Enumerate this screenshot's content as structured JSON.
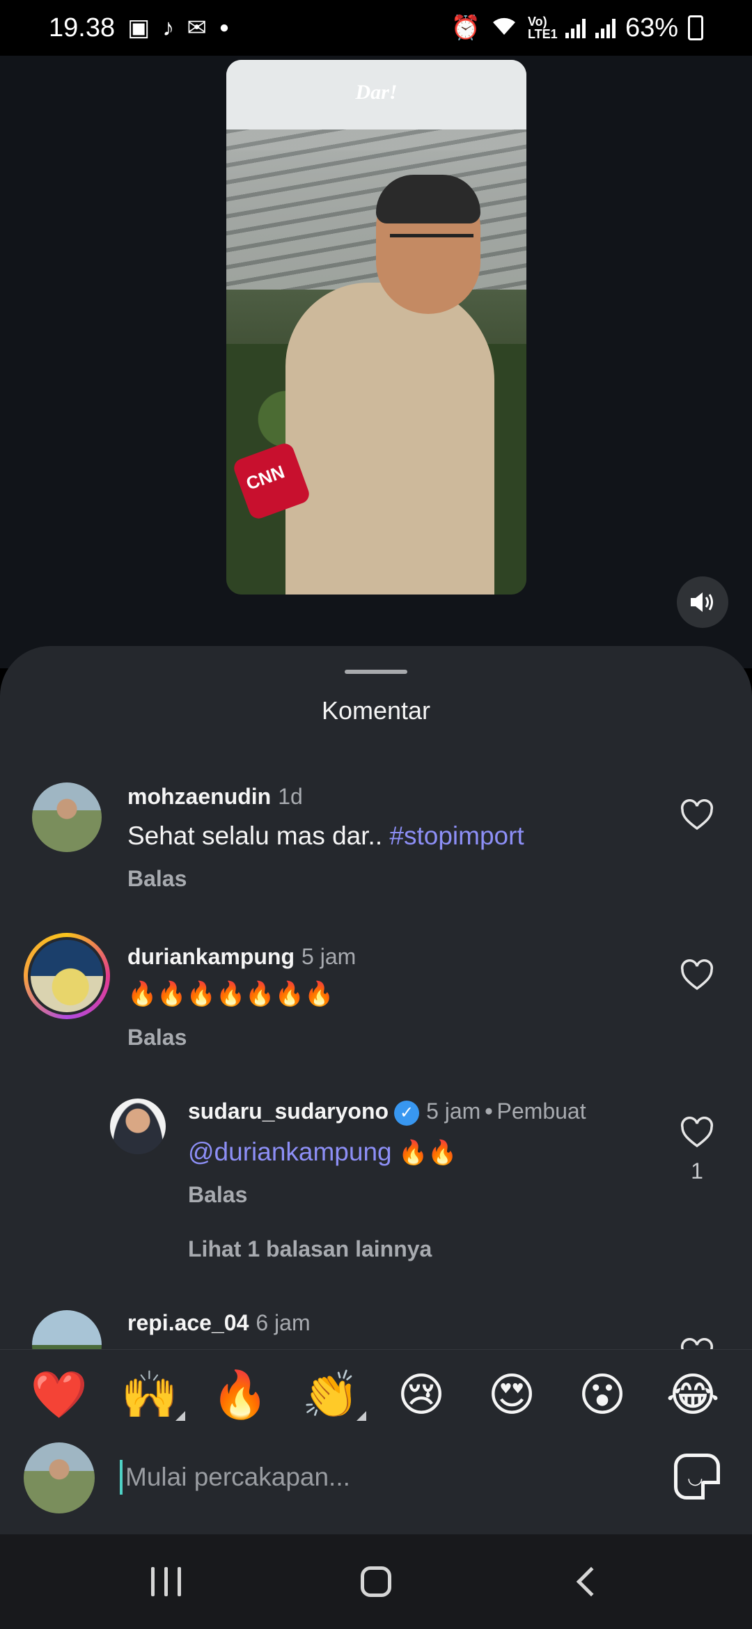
{
  "status_bar": {
    "time": "19.38",
    "network_label": "Vo) LTE1",
    "battery": "63%"
  },
  "video": {
    "watermark": "Dar!",
    "mic_label": "CNN"
  },
  "sheet": {
    "title": "Komentar",
    "comments": [
      {
        "username": "mohzaenudin",
        "time": "1d",
        "text": "Sehat selalu mas dar.. ",
        "hashtag": "#stopimport",
        "reply_label": "Balas"
      },
      {
        "username": "duriankampung",
        "time": "5 jam",
        "text": "🔥🔥🔥🔥🔥🔥🔥",
        "reply_label": "Balas"
      },
      {
        "username": "sudaru_sudaryono",
        "time": "5 jam",
        "badge": "Pembuat",
        "mention": "@duriankampung",
        "text": " 🔥🔥",
        "reply_label": "Balas",
        "likes": "1"
      },
      {
        "username": "repi.ace_04",
        "time": "6 jam"
      }
    ],
    "more_replies": "Lihat 1 balasan lainnya"
  },
  "emoji_bar": [
    "❤️",
    "🙌",
    "🔥",
    "👏",
    "😢",
    "😍",
    "😮",
    "😂"
  ],
  "input": {
    "placeholder": "Mulai percakapan..."
  }
}
